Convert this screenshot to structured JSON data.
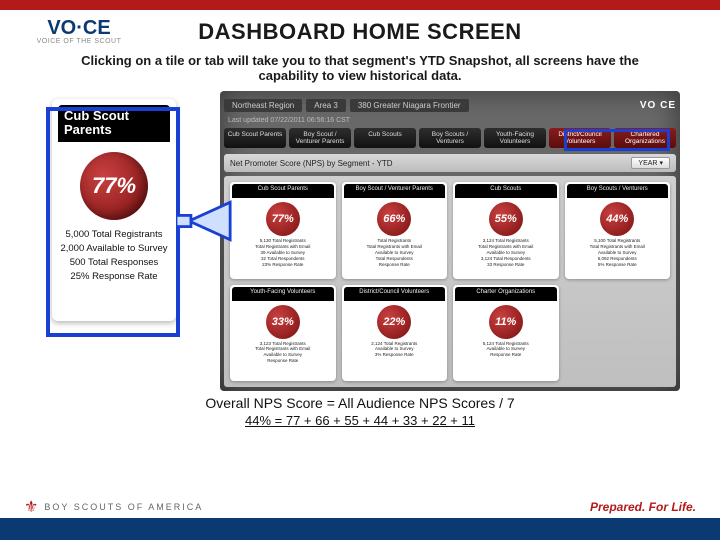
{
  "brand": {
    "logo_main": "VO·CE",
    "logo_sub": "VOICE OF THE SCOUT"
  },
  "page": {
    "title": "DASHBOARD HOME SCREEN",
    "subtitle": "Clicking on a tile or tab will take you to that segment's YTD Snapshot, all screens have the capability to view historical data."
  },
  "highlight_tile": {
    "header_l1": "Cub Scout",
    "header_l2": "Parents",
    "pct": "77%",
    "stats": [
      "5,000 Total Registrants",
      "2,000 Available to Survey",
      "500 Total Responses",
      "25% Response Rate"
    ]
  },
  "dashboard": {
    "crumbs": [
      "Northeast Region",
      "Area 3",
      "380 Greater Niagara Frontier"
    ],
    "logo": "VO CE",
    "updated": "Last updated 07/22/2011 06:56:16 CST",
    "tabs": [
      "Cub Scout Parents",
      "Boy Scout / Venturer Parents",
      "Cub Scouts",
      "Boy Scouts / Venturers",
      "Youth-Facing Volunteers",
      "District/Council Volunteers",
      "Chartered Organizations"
    ],
    "nps_title": "Net Promoter Score (NPS) by Segment - YTD",
    "year_btn": "YEAR",
    "cards": [
      {
        "title": "Cub Scout Parents",
        "pct": "77%",
        "lines": [
          "5,130 Total Registrants",
          "Total Registrants with Email",
          "39 Available to Survey",
          "32 Total Respondents",
          "23% Response Rate"
        ]
      },
      {
        "title": "Boy Scout / Venturer Parents",
        "pct": "66%",
        "lines": [
          "Total Registrants",
          "Total Registrants with Email",
          "Available to Survey",
          "Total Respondents",
          "Response Rate"
        ]
      },
      {
        "title": "Cub Scouts",
        "pct": "55%",
        "lines": [
          "3,124 Total Registrants",
          "Total Registrants with Email",
          "Available to Survey",
          "3,124 Total Respondents",
          "33 Response Rate"
        ]
      },
      {
        "title": "Boy Scouts / Venturers",
        "pct": "44%",
        "lines": [
          "5,100 Total Registrants",
          "Total Registrants with Email",
          "Available to Survey",
          "5,092 Respondents",
          "5% Response Rate"
        ]
      },
      {
        "title": "Youth-Facing Volunteers",
        "pct": "33%",
        "lines": [
          "3,123 Total Registrants",
          "Total Registrants with Email",
          "Available to Survey",
          "Response Rate"
        ]
      },
      {
        "title": "District/Council Volunteers",
        "pct": "22%",
        "lines": [
          "2,124 Total Registrants",
          "Available to Survey",
          "3% Response Rate"
        ]
      },
      {
        "title": "Charter Organizations",
        "pct": "11%",
        "lines": [
          "5,124 Total Registrants",
          "Available to Survey",
          "Response Rate"
        ]
      }
    ]
  },
  "formulas": {
    "line1": "Overall NPS Score = All Audience NPS Scores / 7",
    "line2": "44% = 77 + 66 + 55 + 44 + 33 + 22 + 11"
  },
  "footer": {
    "bsa": "BOY SCOUTS OF AMERICA",
    "tagline": "Prepared. For Life."
  }
}
